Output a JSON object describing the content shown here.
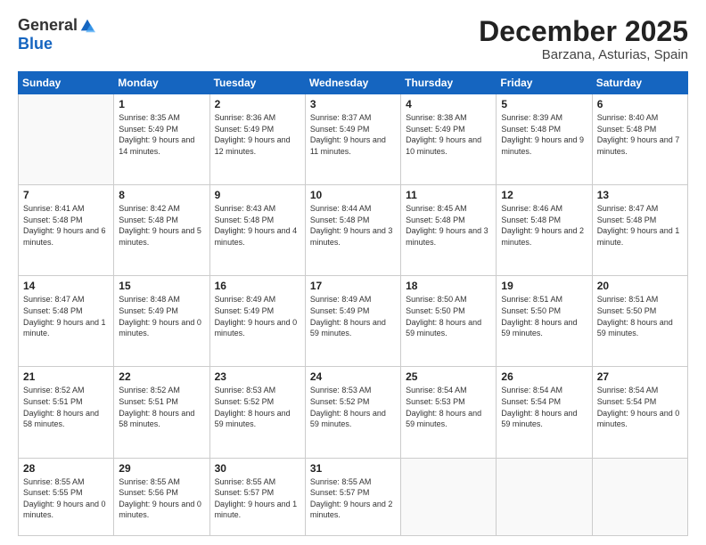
{
  "logo": {
    "general": "General",
    "blue": "Blue"
  },
  "header": {
    "month": "December 2025",
    "location": "Barzana, Asturias, Spain"
  },
  "weekdays": [
    "Sunday",
    "Monday",
    "Tuesday",
    "Wednesday",
    "Thursday",
    "Friday",
    "Saturday"
  ],
  "weeks": [
    [
      {
        "day": "",
        "sunrise": "",
        "sunset": "",
        "daylight": ""
      },
      {
        "day": "1",
        "sunrise": "Sunrise: 8:35 AM",
        "sunset": "Sunset: 5:49 PM",
        "daylight": "Daylight: 9 hours and 14 minutes."
      },
      {
        "day": "2",
        "sunrise": "Sunrise: 8:36 AM",
        "sunset": "Sunset: 5:49 PM",
        "daylight": "Daylight: 9 hours and 12 minutes."
      },
      {
        "day": "3",
        "sunrise": "Sunrise: 8:37 AM",
        "sunset": "Sunset: 5:49 PM",
        "daylight": "Daylight: 9 hours and 11 minutes."
      },
      {
        "day": "4",
        "sunrise": "Sunrise: 8:38 AM",
        "sunset": "Sunset: 5:49 PM",
        "daylight": "Daylight: 9 hours and 10 minutes."
      },
      {
        "day": "5",
        "sunrise": "Sunrise: 8:39 AM",
        "sunset": "Sunset: 5:48 PM",
        "daylight": "Daylight: 9 hours and 9 minutes."
      },
      {
        "day": "6",
        "sunrise": "Sunrise: 8:40 AM",
        "sunset": "Sunset: 5:48 PM",
        "daylight": "Daylight: 9 hours and 7 minutes."
      }
    ],
    [
      {
        "day": "7",
        "sunrise": "Sunrise: 8:41 AM",
        "sunset": "Sunset: 5:48 PM",
        "daylight": "Daylight: 9 hours and 6 minutes."
      },
      {
        "day": "8",
        "sunrise": "Sunrise: 8:42 AM",
        "sunset": "Sunset: 5:48 PM",
        "daylight": "Daylight: 9 hours and 5 minutes."
      },
      {
        "day": "9",
        "sunrise": "Sunrise: 8:43 AM",
        "sunset": "Sunset: 5:48 PM",
        "daylight": "Daylight: 9 hours and 4 minutes."
      },
      {
        "day": "10",
        "sunrise": "Sunrise: 8:44 AM",
        "sunset": "Sunset: 5:48 PM",
        "daylight": "Daylight: 9 hours and 3 minutes."
      },
      {
        "day": "11",
        "sunrise": "Sunrise: 8:45 AM",
        "sunset": "Sunset: 5:48 PM",
        "daylight": "Daylight: 9 hours and 3 minutes."
      },
      {
        "day": "12",
        "sunrise": "Sunrise: 8:46 AM",
        "sunset": "Sunset: 5:48 PM",
        "daylight": "Daylight: 9 hours and 2 minutes."
      },
      {
        "day": "13",
        "sunrise": "Sunrise: 8:47 AM",
        "sunset": "Sunset: 5:48 PM",
        "daylight": "Daylight: 9 hours and 1 minute."
      }
    ],
    [
      {
        "day": "14",
        "sunrise": "Sunrise: 8:47 AM",
        "sunset": "Sunset: 5:48 PM",
        "daylight": "Daylight: 9 hours and 1 minute."
      },
      {
        "day": "15",
        "sunrise": "Sunrise: 8:48 AM",
        "sunset": "Sunset: 5:49 PM",
        "daylight": "Daylight: 9 hours and 0 minutes."
      },
      {
        "day": "16",
        "sunrise": "Sunrise: 8:49 AM",
        "sunset": "Sunset: 5:49 PM",
        "daylight": "Daylight: 9 hours and 0 minutes."
      },
      {
        "day": "17",
        "sunrise": "Sunrise: 8:49 AM",
        "sunset": "Sunset: 5:49 PM",
        "daylight": "Daylight: 8 hours and 59 minutes."
      },
      {
        "day": "18",
        "sunrise": "Sunrise: 8:50 AM",
        "sunset": "Sunset: 5:50 PM",
        "daylight": "Daylight: 8 hours and 59 minutes."
      },
      {
        "day": "19",
        "sunrise": "Sunrise: 8:51 AM",
        "sunset": "Sunset: 5:50 PM",
        "daylight": "Daylight: 8 hours and 59 minutes."
      },
      {
        "day": "20",
        "sunrise": "Sunrise: 8:51 AM",
        "sunset": "Sunset: 5:50 PM",
        "daylight": "Daylight: 8 hours and 59 minutes."
      }
    ],
    [
      {
        "day": "21",
        "sunrise": "Sunrise: 8:52 AM",
        "sunset": "Sunset: 5:51 PM",
        "daylight": "Daylight: 8 hours and 58 minutes."
      },
      {
        "day": "22",
        "sunrise": "Sunrise: 8:52 AM",
        "sunset": "Sunset: 5:51 PM",
        "daylight": "Daylight: 8 hours and 58 minutes."
      },
      {
        "day": "23",
        "sunrise": "Sunrise: 8:53 AM",
        "sunset": "Sunset: 5:52 PM",
        "daylight": "Daylight: 8 hours and 59 minutes."
      },
      {
        "day": "24",
        "sunrise": "Sunrise: 8:53 AM",
        "sunset": "Sunset: 5:52 PM",
        "daylight": "Daylight: 8 hours and 59 minutes."
      },
      {
        "day": "25",
        "sunrise": "Sunrise: 8:54 AM",
        "sunset": "Sunset: 5:53 PM",
        "daylight": "Daylight: 8 hours and 59 minutes."
      },
      {
        "day": "26",
        "sunrise": "Sunrise: 8:54 AM",
        "sunset": "Sunset: 5:54 PM",
        "daylight": "Daylight: 8 hours and 59 minutes."
      },
      {
        "day": "27",
        "sunrise": "Sunrise: 8:54 AM",
        "sunset": "Sunset: 5:54 PM",
        "daylight": "Daylight: 9 hours and 0 minutes."
      }
    ],
    [
      {
        "day": "28",
        "sunrise": "Sunrise: 8:55 AM",
        "sunset": "Sunset: 5:55 PM",
        "daylight": "Daylight: 9 hours and 0 minutes."
      },
      {
        "day": "29",
        "sunrise": "Sunrise: 8:55 AM",
        "sunset": "Sunset: 5:56 PM",
        "daylight": "Daylight: 9 hours and 0 minutes."
      },
      {
        "day": "30",
        "sunrise": "Sunrise: 8:55 AM",
        "sunset": "Sunset: 5:57 PM",
        "daylight": "Daylight: 9 hours and 1 minute."
      },
      {
        "day": "31",
        "sunrise": "Sunrise: 8:55 AM",
        "sunset": "Sunset: 5:57 PM",
        "daylight": "Daylight: 9 hours and 2 minutes."
      },
      {
        "day": "",
        "sunrise": "",
        "sunset": "",
        "daylight": ""
      },
      {
        "day": "",
        "sunrise": "",
        "sunset": "",
        "daylight": ""
      },
      {
        "day": "",
        "sunrise": "",
        "sunset": "",
        "daylight": ""
      }
    ]
  ]
}
